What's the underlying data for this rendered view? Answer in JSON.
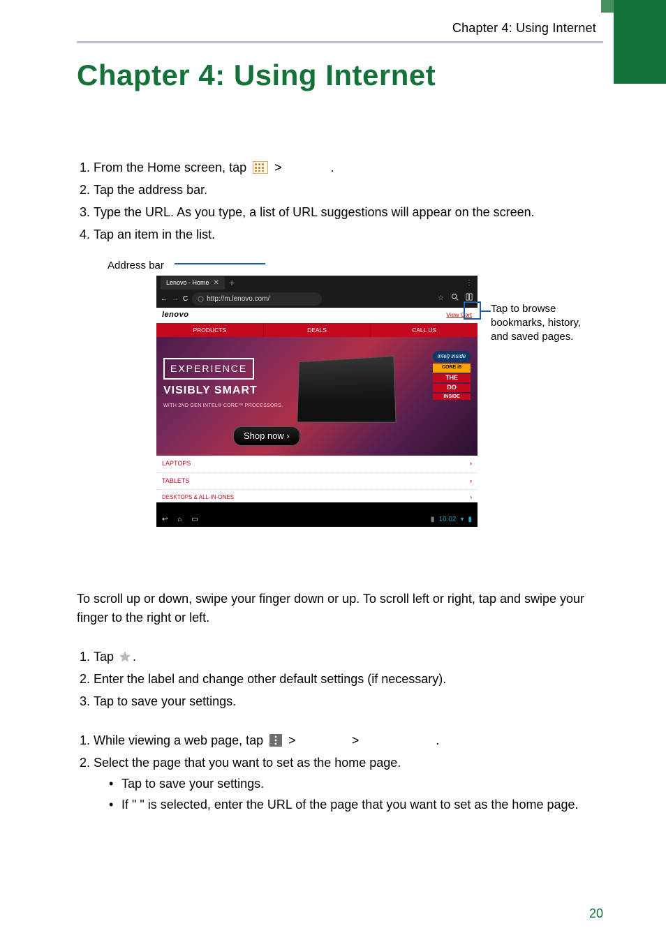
{
  "running_head": "Chapter 4: Using Internet",
  "chapter_title": "Chapter 4: Using Internet",
  "steps_a": [
    "From the Home screen, tap ",
    "Tap the address bar.",
    "Type the URL. As you type, a list of URL suggestions will appear on the screen.",
    "Tap an item in the list."
  ],
  "steps_a_tail": [
    " > ",
    "."
  ],
  "callout_address_bar": "Address bar",
  "callout_right": "Tap to browse bookmarks, history, and saved pages.",
  "screenshot": {
    "tab_label": "Lenovo - Home",
    "url": "http://m.lenovo.com/",
    "logo": "lenovo",
    "view_cart": "View Cart",
    "nav": [
      "PRODUCTS",
      "DEALS",
      "CALL US"
    ],
    "hero_experience": "EXPERIENCE",
    "hero_vs": "VISIBLY SMART",
    "hero_sub": "WITH 2ND GEN INTEL® CORE™ PROCESSORS.",
    "shop_now": "Shop now ›",
    "badge_intel": "intel) inside",
    "badge_core": "CORE i5",
    "badge_red1": "THE",
    "badge_red2": "DO",
    "badge_red3": "INSIDE",
    "list": [
      "LAPTOPS",
      "TABLETS",
      "DESKTOPS & ALL-IN-ONES"
    ],
    "clock": "10:02"
  },
  "scroll_para": "To scroll up or down, swipe your finger down or up. To scroll left or right, tap and swipe your finger to the right or left.",
  "steps_b": [
    "Tap ",
    "Enter the label and change other default settings (if necessary).",
    "Tap      to save your settings."
  ],
  "steps_b_tail": ".",
  "steps_c_1_pre": "While viewing a web page, tap ",
  "steps_c_1_mid1": " > ",
  "steps_c_1_mid2": "> ",
  "steps_c_1_end": ".",
  "steps_c_2": "Select the page that you want to set as the home page.",
  "bullets": [
    "Tap       to save your settings.",
    "If \"        \" is selected, enter the URL of the page that you want to set as the home page."
  ],
  "page_number": "20"
}
